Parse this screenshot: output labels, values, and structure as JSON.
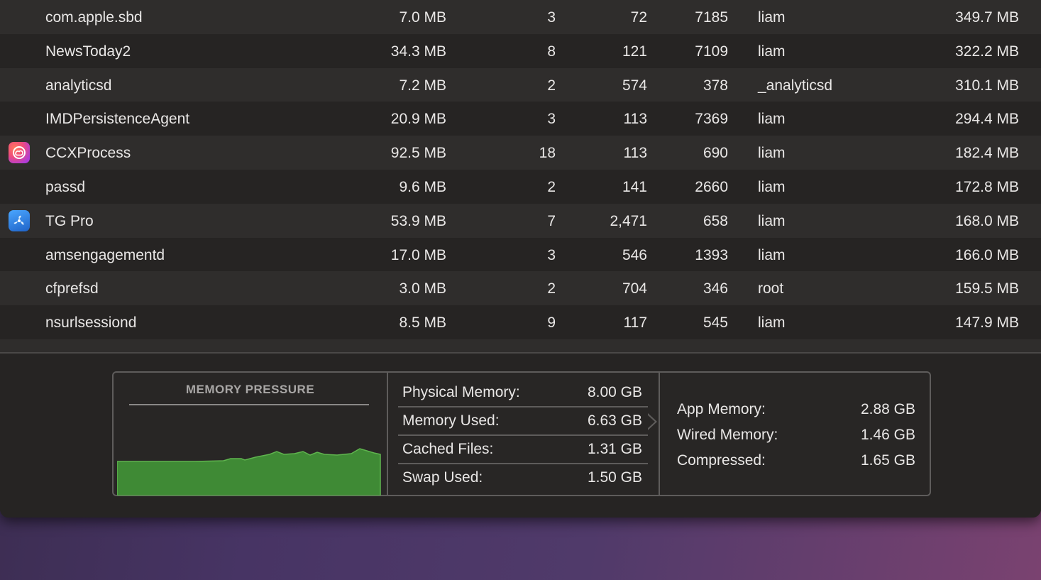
{
  "processes": [
    {
      "name": "com.apple.sbd",
      "memory": "7.0 MB",
      "threads": "3",
      "ports": "72",
      "pid": "7185",
      "user": "liam",
      "size": "349.7 MB",
      "icon": ""
    },
    {
      "name": "NewsToday2",
      "memory": "34.3 MB",
      "threads": "8",
      "ports": "121",
      "pid": "7109",
      "user": "liam",
      "size": "322.2 MB",
      "icon": ""
    },
    {
      "name": "analyticsd",
      "memory": "7.2 MB",
      "threads": "2",
      "ports": "574",
      "pid": "378",
      "user": "_analyticsd",
      "size": "310.1 MB",
      "icon": ""
    },
    {
      "name": "IMDPersistenceAgent",
      "memory": "20.9 MB",
      "threads": "3",
      "ports": "113",
      "pid": "7369",
      "user": "liam",
      "size": "294.4 MB",
      "icon": ""
    },
    {
      "name": "CCXProcess",
      "memory": "92.5 MB",
      "threads": "18",
      "ports": "113",
      "pid": "690",
      "user": "liam",
      "size": "182.4 MB",
      "icon": "creative-cloud-icon"
    },
    {
      "name": "passd",
      "memory": "9.6 MB",
      "threads": "2",
      "ports": "141",
      "pid": "2660",
      "user": "liam",
      "size": "172.8 MB",
      "icon": ""
    },
    {
      "name": "TG Pro",
      "memory": "53.9 MB",
      "threads": "7",
      "ports": "2,471",
      "pid": "658",
      "user": "liam",
      "size": "168.0 MB",
      "icon": "tg-pro-icon"
    },
    {
      "name": "amsengagementd",
      "memory": "17.0 MB",
      "threads": "3",
      "ports": "546",
      "pid": "1393",
      "user": "liam",
      "size": "166.0 MB",
      "icon": ""
    },
    {
      "name": "cfprefsd",
      "memory": "3.0 MB",
      "threads": "2",
      "ports": "704",
      "pid": "346",
      "user": "root",
      "size": "159.5 MB",
      "icon": ""
    },
    {
      "name": "nsurlsessiond",
      "memory": "8.5 MB",
      "threads": "9",
      "ports": "117",
      "pid": "545",
      "user": "liam",
      "size": "147.9 MB",
      "icon": ""
    }
  ],
  "memory_pressure": {
    "title": "MEMORY PRESSURE",
    "color": "#3f8a35"
  },
  "stats_primary": [
    {
      "label": "Physical Memory:",
      "value": "8.00 GB"
    },
    {
      "label": "Memory Used:",
      "value": "6.63 GB"
    },
    {
      "label": "Cached Files:",
      "value": "1.31 GB"
    },
    {
      "label": "Swap Used:",
      "value": "1.50 GB"
    }
  ],
  "stats_breakdown": [
    {
      "label": "App Memory:",
      "value": "2.88 GB"
    },
    {
      "label": "Wired Memory:",
      "value": "1.46 GB"
    },
    {
      "label": "Compressed:",
      "value": "1.65 GB"
    }
  ]
}
